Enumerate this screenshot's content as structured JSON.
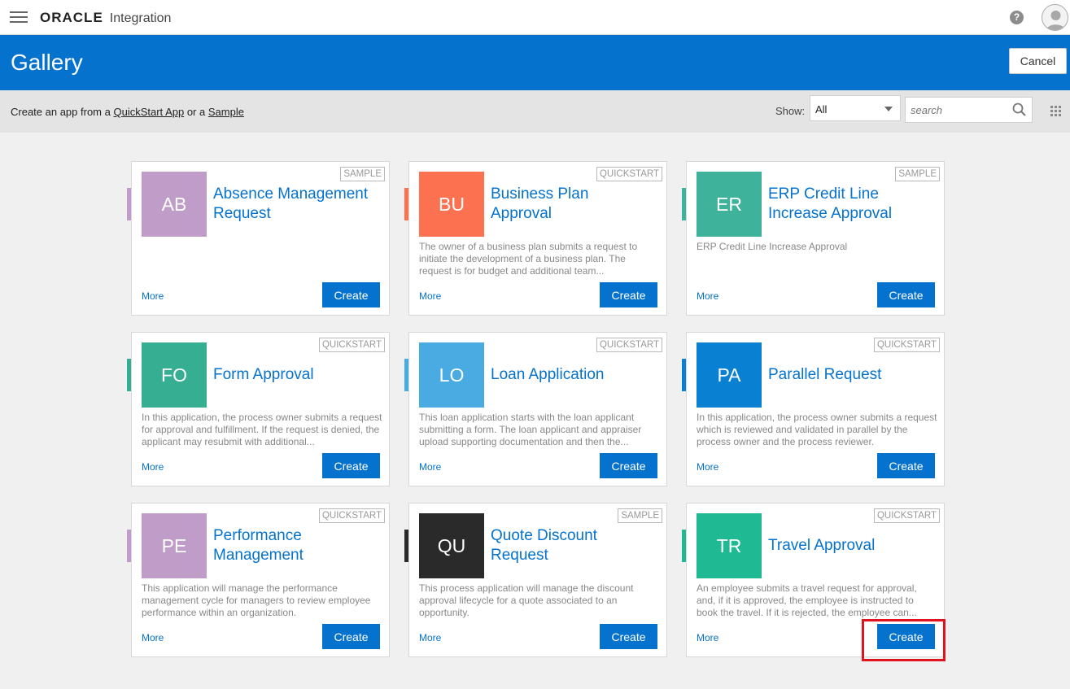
{
  "topbar": {
    "brand": "ORACLE",
    "product": "Integration",
    "help_glyph": "?"
  },
  "header": {
    "title": "Gallery",
    "cancel_label": "Cancel"
  },
  "toolbar": {
    "intro": "Create an app from a",
    "quickstart_link": "QuickStart App",
    "or_text": "or a",
    "sample_link": "Sample",
    "show_label": "Show:",
    "show_value": "All",
    "search_placeholder": "search"
  },
  "cards": [
    {
      "initials": "AB",
      "color": "#c09cc8",
      "tag": "SAMPLE",
      "title_lines": [
        "Absence Management",
        "Request"
      ],
      "description": "",
      "more": "More",
      "create": "Create"
    },
    {
      "initials": "BU",
      "color": "#fc7150",
      "tag": "QUICKSTART",
      "title_lines": [
        "Business Plan",
        "Approval"
      ],
      "description": "The owner of a business plan submits a request to initiate the development of a business plan. The request is for budget and additional team...",
      "more": "More",
      "create": "Create"
    },
    {
      "initials": "ER",
      "color": "#3eb29a",
      "tag": "SAMPLE",
      "title_lines": [
        "ERP Credit Line",
        "Increase Approval"
      ],
      "description": "ERP Credit Line Increase Approval",
      "more": "More",
      "create": "Create"
    },
    {
      "initials": "FO",
      "color": "#35ae91",
      "tag": "QUICKSTART",
      "title_lines": [
        "Form Approval"
      ],
      "description": "In this application, the process owner submits a request for approval and fulfillment. If the request is denied, the applicant may resubmit with additional...",
      "more": "More",
      "create": "Create"
    },
    {
      "initials": "LO",
      "color": "#4aabe3",
      "tag": "QUICKSTART",
      "title_lines": [
        "Loan Application"
      ],
      "description": "This loan application starts with the loan applicant submitting a form. The loan applicant and appraiser upload supporting documentation and then the...",
      "more": "More",
      "create": "Create"
    },
    {
      "initials": "PA",
      "color": "#0a80d2",
      "tag": "QUICKSTART",
      "title_lines": [
        "Parallel Request"
      ],
      "description": "In this application, the process owner submits a request which is reviewed and validated in parallel by the process owner and the process reviewer.",
      "more": "More",
      "create": "Create"
    },
    {
      "initials": "PE",
      "color": "#c09cc8",
      "tag": "QUICKSTART",
      "title_lines": [
        "Performance",
        "Management"
      ],
      "description": "This application will manage the performance management cycle for managers to review employee performance within an organization.",
      "more": "More",
      "create": "Create"
    },
    {
      "initials": "QU",
      "color": "#2a2a2a",
      "tag": "SAMPLE",
      "title_lines": [
        "Quote Discount",
        "Request"
      ],
      "description": "This process application will manage the discount approval lifecycle for a quote associated to an opportunity.",
      "more": "More",
      "create": "Create"
    },
    {
      "initials": "TR",
      "color": "#1fb993",
      "tag": "QUICKSTART",
      "title_lines": [
        "Travel Approval"
      ],
      "description": "An employee submits a travel request for approval, and, if it is approved, the employee is instructed to book the travel. If it is rejected, the employee can...",
      "more": "More",
      "create": "Create"
    }
  ]
}
